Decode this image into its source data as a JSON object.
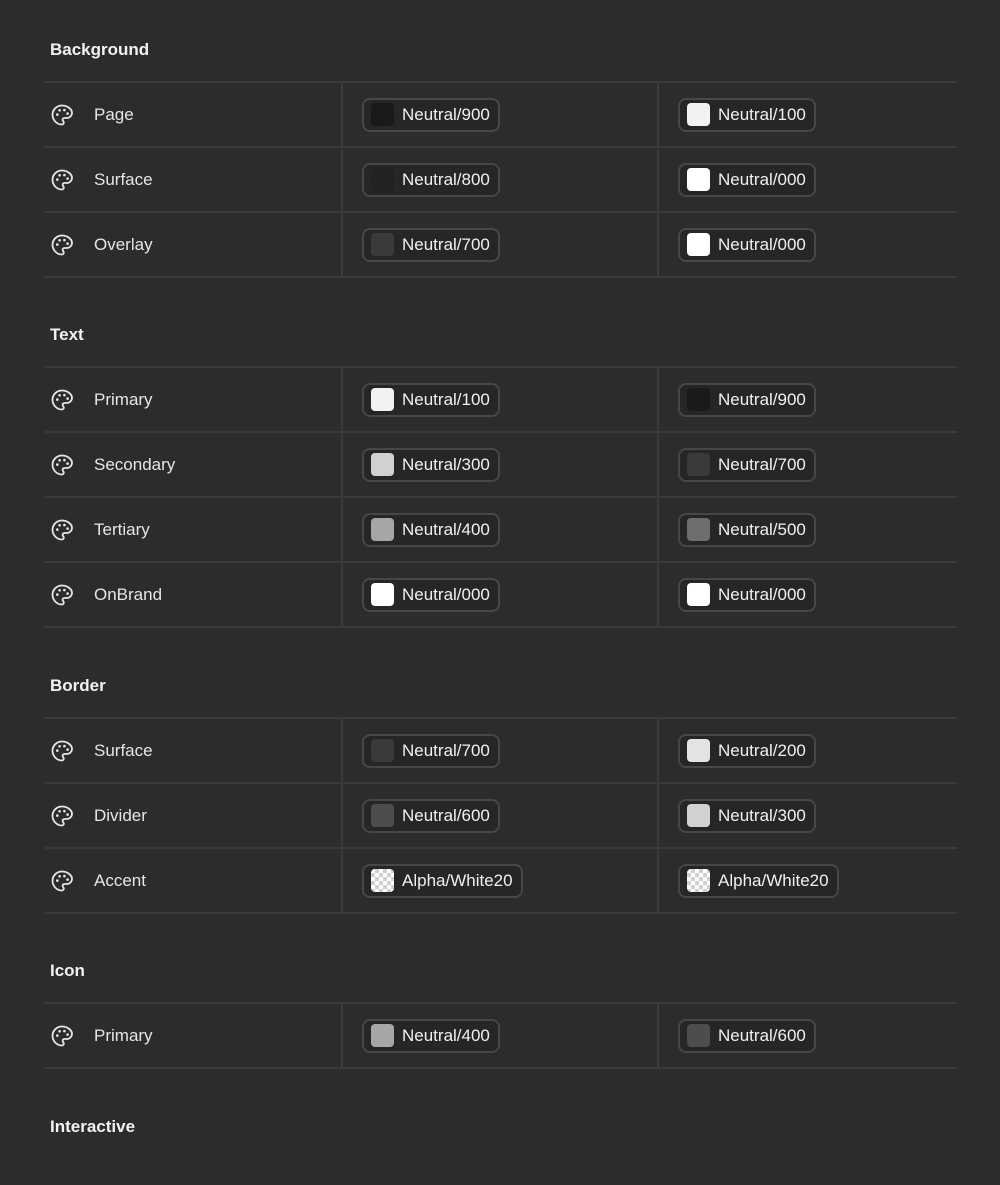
{
  "sections": [
    {
      "title": "Background",
      "rows": [
        {
          "name": "Page",
          "light": {
            "label": "Neutral/900",
            "swatch": "#1a1a1a"
          },
          "dark": {
            "label": "Neutral/100",
            "swatch": "#f2f2f2"
          }
        },
        {
          "name": "Surface",
          "light": {
            "label": "Neutral/800",
            "swatch": "#222222"
          },
          "dark": {
            "label": "Neutral/000",
            "swatch": "#ffffff"
          }
        },
        {
          "name": "Overlay",
          "light": {
            "label": "Neutral/700",
            "swatch": "#3a3a3a"
          },
          "dark": {
            "label": "Neutral/000",
            "swatch": "#ffffff"
          }
        }
      ]
    },
    {
      "title": "Text",
      "rows": [
        {
          "name": "Primary",
          "light": {
            "label": "Neutral/100",
            "swatch": "#f2f2f2"
          },
          "dark": {
            "label": "Neutral/900",
            "swatch": "#1a1a1a"
          }
        },
        {
          "name": "Secondary",
          "light": {
            "label": "Neutral/300",
            "swatch": "#d1d1d1"
          },
          "dark": {
            "label": "Neutral/700",
            "swatch": "#3a3a3a"
          }
        },
        {
          "name": "Tertiary",
          "light": {
            "label": "Neutral/400",
            "swatch": "#a6a6a6"
          },
          "dark": {
            "label": "Neutral/500",
            "swatch": "#6e6e6e"
          }
        },
        {
          "name": "OnBrand",
          "light": {
            "label": "Neutral/000",
            "swatch": "#ffffff"
          },
          "dark": {
            "label": "Neutral/000",
            "swatch": "#ffffff"
          }
        }
      ]
    },
    {
      "title": "Border",
      "rows": [
        {
          "name": "Surface",
          "light": {
            "label": "Neutral/700",
            "swatch": "#3a3a3a"
          },
          "dark": {
            "label": "Neutral/200",
            "swatch": "#e3e3e3"
          }
        },
        {
          "name": "Divider",
          "light": {
            "label": "Neutral/600",
            "swatch": "#4d4d4d"
          },
          "dark": {
            "label": "Neutral/300",
            "swatch": "#d1d1d1"
          }
        },
        {
          "name": "Accent",
          "light": {
            "label": "Alpha/White20",
            "swatch": "checker"
          },
          "dark": {
            "label": "Alpha/White20",
            "swatch": "checker"
          }
        }
      ]
    },
    {
      "title": "Icon",
      "rows": [
        {
          "name": "Primary",
          "light": {
            "label": "Neutral/400",
            "swatch": "#a6a6a6"
          },
          "dark": {
            "label": "Neutral/600",
            "swatch": "#4d4d4d"
          }
        }
      ]
    },
    {
      "title": "Interactive",
      "rows": []
    }
  ],
  "icon": "palette-icon"
}
